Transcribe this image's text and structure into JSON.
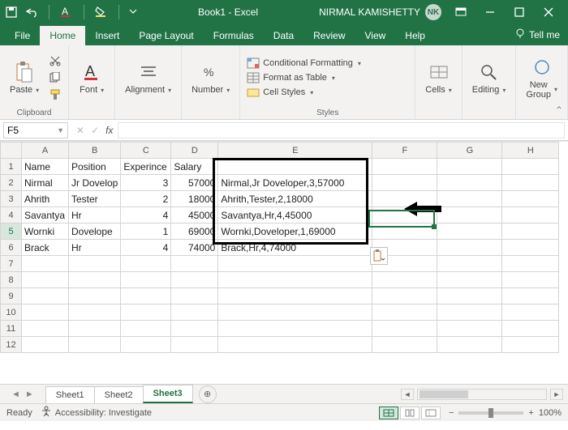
{
  "titlebar": {
    "doc_title": "Book1 - Excel",
    "user_name": "NIRMAL KAMISHETTY",
    "user_initials": "NK"
  },
  "ribbon_tabs": {
    "file": "File",
    "home": "Home",
    "insert": "Insert",
    "page_layout": "Page Layout",
    "formulas": "Formulas",
    "data": "Data",
    "review": "Review",
    "view": "View",
    "help": "Help",
    "tell_me": "Tell me"
  },
  "ribbon": {
    "clipboard": {
      "label": "Clipboard",
      "paste": "Paste"
    },
    "font": {
      "label": "Font",
      "btn": "Font"
    },
    "alignment": {
      "label": "Alignment",
      "btn": "Alignment"
    },
    "number": {
      "label": "Number",
      "btn": "Number"
    },
    "styles": {
      "label": "Styles",
      "cond_fmt": "Conditional Formatting",
      "as_table": "Format as Table",
      "cell_styles": "Cell Styles"
    },
    "cells": {
      "label": "Cells",
      "btn": "Cells"
    },
    "editing": {
      "label": "Editing",
      "btn": "Editing"
    },
    "new_group": {
      "label": "New Group",
      "btn": "New\nGroup"
    }
  },
  "namebox": "F5",
  "columns": [
    "A",
    "B",
    "C",
    "D",
    "E",
    "F",
    "G",
    "H"
  ],
  "rows_shown": 12,
  "header_row": {
    "A": "Name",
    "B": "Position",
    "C": "Experince",
    "D": "Salary"
  },
  "data_rows": [
    {
      "A": "Nirmal",
      "B": "Jr Dovelop",
      "C": "3",
      "D": "57000",
      "E": "Nirmal,Jr Doveloper,3,57000"
    },
    {
      "A": "Ahrith",
      "B": "Tester",
      "C": "2",
      "D": "18000",
      "E": "Ahrith,Tester,2,18000"
    },
    {
      "A": "Savantya",
      "B": "Hr",
      "C": "4",
      "D": "45000",
      "E": "Savantya,Hr,4,45000"
    },
    {
      "A": "Wornki",
      "B": "Dovelope",
      "C": "1",
      "D": "69000",
      "E": "Wornki,Doveloper,1,69000"
    },
    {
      "A": "Brack",
      "B": "Hr",
      "C": "4",
      "D": "74000",
      "E": "Brack,Hr,4,74000"
    }
  ],
  "sheets": {
    "s1": "Sheet1",
    "s2": "Sheet2",
    "s3": "Sheet3"
  },
  "status": {
    "ready": "Ready",
    "accessibility": "Accessibility: Investigate",
    "zoom": "100%"
  }
}
